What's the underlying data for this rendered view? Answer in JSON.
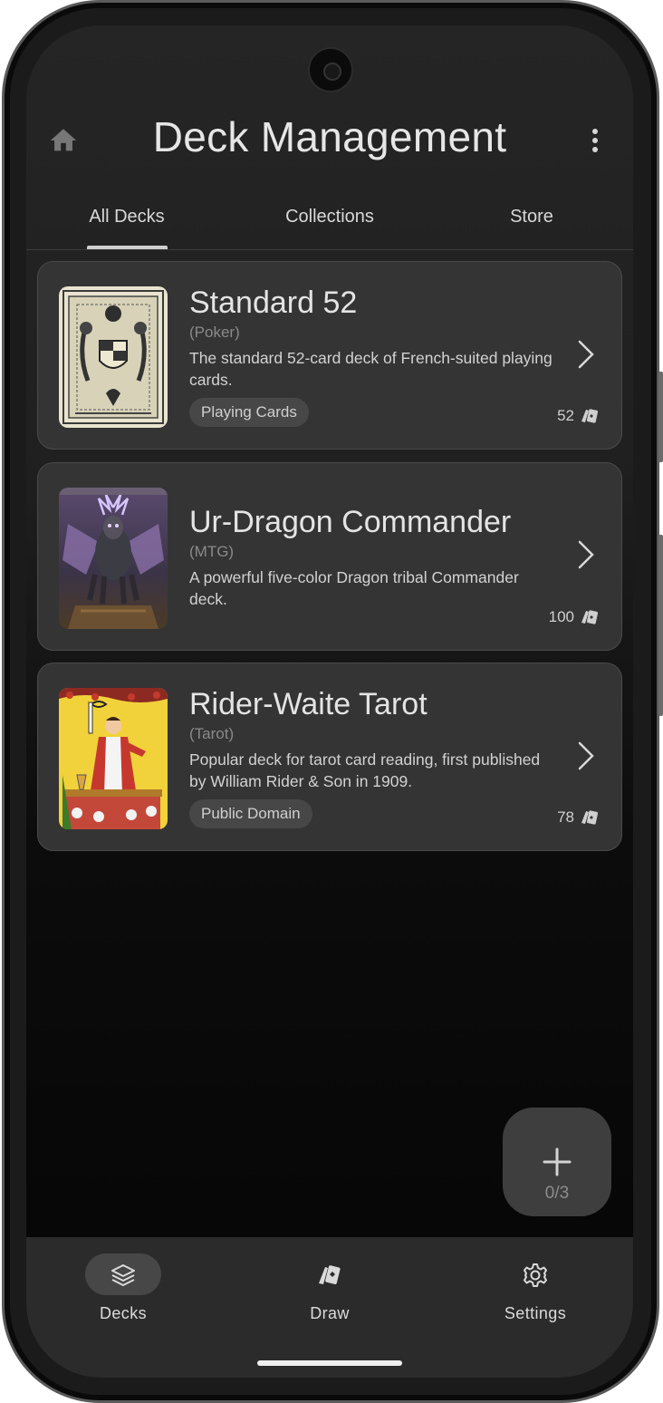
{
  "header": {
    "title": "Deck Management",
    "home_icon": "home-icon",
    "menu_icon": "more-vert-icon"
  },
  "tabs": [
    {
      "label": "All Decks",
      "active": true
    },
    {
      "label": "Collections",
      "active": false
    },
    {
      "label": "Store",
      "active": false
    }
  ],
  "decks": [
    {
      "name": "Standard 52",
      "game": "(Poker)",
      "description": "The standard 52-card deck of French-suited playing cards.",
      "tag": "Playing Cards",
      "count": "52",
      "thumbnail": "ornate-card-back-thumbnail"
    },
    {
      "name": "Ur-Dragon Commander",
      "game": "(MTG)",
      "description": "A powerful five-color Dragon tribal Commander deck.",
      "tag": "",
      "count": "100",
      "thumbnail": "dragon-art-thumbnail"
    },
    {
      "name": "Rider-Waite Tarot",
      "game": "(Tarot)",
      "description": "Popular deck for tarot card reading, first published by William Rider & Son in 1909.",
      "tag": "Public Domain",
      "count": "78",
      "thumbnail": "magician-tarot-thumbnail"
    }
  ],
  "fab": {
    "icon": "plus-icon",
    "count": "0/3"
  },
  "bottom_nav": [
    {
      "label": "Decks",
      "icon": "layers-icon",
      "active": true
    },
    {
      "label": "Draw",
      "icon": "cards-icon",
      "active": false
    },
    {
      "label": "Settings",
      "icon": "gear-icon",
      "active": false
    }
  ],
  "colors": {
    "background": "#202020",
    "card": "#343434",
    "text_primary": "#e4e4e4",
    "text_secondary": "#8a8a8a",
    "chip": "#474747"
  }
}
